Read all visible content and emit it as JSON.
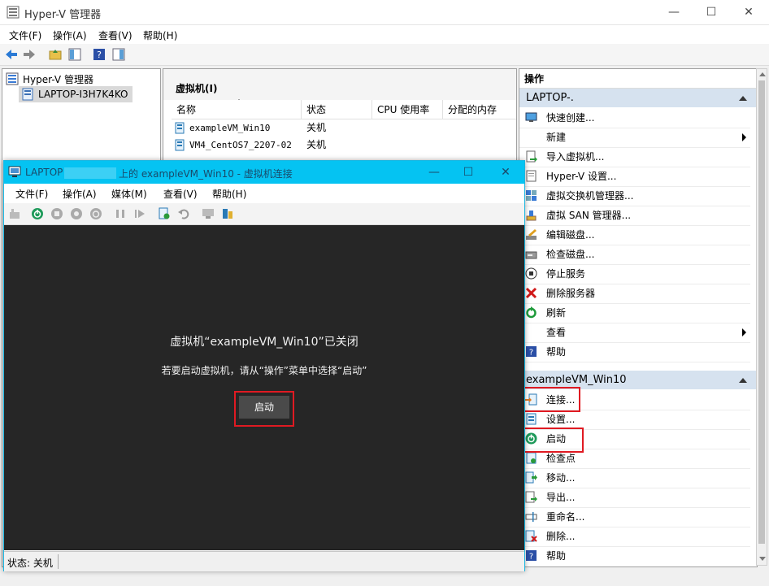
{
  "main": {
    "title": "Hyper-V 管理器",
    "menu": [
      "文件(F)",
      "操作(A)",
      "查看(V)",
      "帮助(H)"
    ]
  },
  "tree": {
    "root": "Hyper-V 管理器",
    "server": "LAPTOP-I3H7K4KO"
  },
  "vms": {
    "header": "虚拟机(I)",
    "columns": [
      "名称",
      "状态",
      "CPU 使用率",
      "分配的内存"
    ],
    "rows": [
      {
        "name": "exampleVM_Win10",
        "state": "关机"
      },
      {
        "name": "VM4_CentOS7_2207-02",
        "state": "关机"
      }
    ]
  },
  "actions": {
    "title": "操作",
    "server_section": "LAPTOP-.",
    "server_items": [
      "快速创建...",
      "新建",
      "导入虚拟机...",
      "Hyper-V 设置...",
      "虚拟交换机管理器...",
      "虚拟 SAN 管理器...",
      "编辑磁盘...",
      "检查磁盘...",
      "停止服务",
      "删除服务器",
      "刷新",
      "查看",
      "帮助"
    ],
    "vm_section": "exampleVM_Win10",
    "vm_items": [
      "连接...",
      "设置...",
      "启动",
      "检查点",
      "移动...",
      "导出...",
      "重命名...",
      "删除...",
      "帮助"
    ]
  },
  "vmconnect": {
    "title_prefix": "LAPTOP",
    "title_suffix": "上的 exampleVM_Win10 - 虚拟机连接",
    "menu": [
      "文件(F)",
      "操作(A)",
      "媒体(M)",
      "查看(V)",
      "帮助(H)"
    ],
    "message": "虚拟机“exampleVM_Win10”已关闭",
    "hint": "若要启动虚拟机，请从“操作”菜单中选择“启动”",
    "start_button": "启动",
    "status": "状态: 关机"
  },
  "colors": {
    "accent": "#05c3f2",
    "highlight": "#e01a22",
    "section": "#d6e2ef"
  }
}
